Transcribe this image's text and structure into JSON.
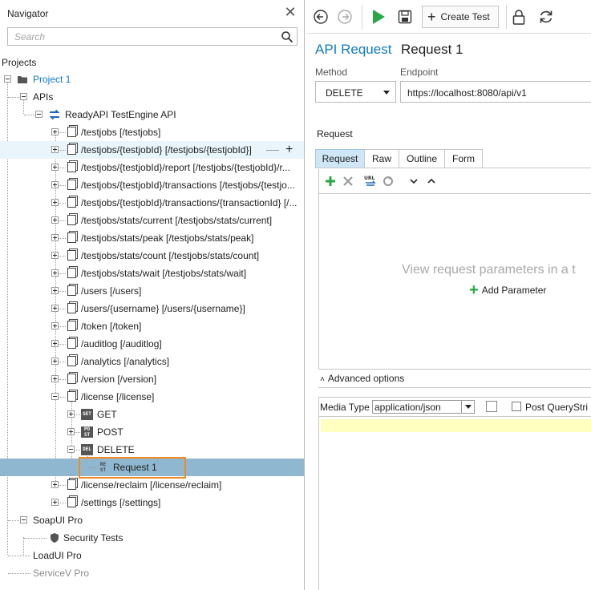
{
  "navigator": {
    "title": "Navigator",
    "search_placeholder": "Search",
    "projects_label": "Projects",
    "tree": [
      {
        "label": "Project 1",
        "icon": "folder-icon",
        "accent": true
      },
      {
        "label": "APIs"
      },
      {
        "label": "ReadyAPI TestEngine API",
        "icon": "api-icon"
      },
      {
        "label": "/testjobs [/testjobs]",
        "icon": "resource-icon"
      },
      {
        "label": "/testjobs/{testjobId} [/testjobs/{testjobId}]",
        "icon": "resource-icon"
      },
      {
        "label": "/testjobs/{testjobId}/report [/testjobs/{testjobId}/r...",
        "icon": "resource-icon"
      },
      {
        "label": "/testjobs/{testjobId}/transactions [/testjobs/{testjo...",
        "icon": "resource-icon"
      },
      {
        "label": "/testjobs/{testjobId}/transactions/{transactionId} [/...",
        "icon": "resource-icon"
      },
      {
        "label": "/testjobs/stats/current [/testjobs/stats/current]",
        "icon": "resource-icon"
      },
      {
        "label": "/testjobs/stats/peak [/testjobs/stats/peak]",
        "icon": "resource-icon"
      },
      {
        "label": "/testjobs/stats/count [/testjobs/stats/count]",
        "icon": "resource-icon"
      },
      {
        "label": "/testjobs/stats/wait [/testjobs/stats/wait]",
        "icon": "resource-icon"
      },
      {
        "label": "/users [/users]",
        "icon": "resource-icon"
      },
      {
        "label": "/users/{username} [/users/{username}]",
        "icon": "resource-icon"
      },
      {
        "label": "/token [/token]",
        "icon": "resource-icon"
      },
      {
        "label": "/auditlog [/auditlog]",
        "icon": "resource-icon"
      },
      {
        "label": "/analytics [/analytics]",
        "icon": "resource-icon"
      },
      {
        "label": "/version [/version]",
        "icon": "resource-icon"
      },
      {
        "label": "/license [/license]",
        "icon": "resource-icon"
      },
      {
        "label": "GET",
        "icon": "get-method-icon",
        "badge": "GET"
      },
      {
        "label": "POST",
        "icon": "post-method-icon",
        "badge": "POST"
      },
      {
        "label": "DELETE",
        "icon": "delete-method-icon",
        "badge": "DEL"
      },
      {
        "label": "Request 1",
        "icon": "rest-request-icon",
        "badge": "REST"
      },
      {
        "label": "/license/reclaim [/license/reclaim]",
        "icon": "resource-icon"
      },
      {
        "label": "/settings [/settings]",
        "icon": "resource-icon"
      },
      {
        "label": "SoapUI Pro"
      },
      {
        "label": "Security Tests",
        "icon": "shield-icon"
      },
      {
        "label": "LoadUI Pro"
      },
      {
        "label": "ServiceV Pro"
      }
    ]
  },
  "toolbar": {
    "back_icon": "back-icon",
    "forward_icon": "forward-icon",
    "run_icon": "run-icon",
    "save_icon": "save-icon",
    "create_test_label": "Create Test",
    "lock_icon": "lock-icon",
    "refresh_icon": "refresh-icon"
  },
  "request": {
    "type": "API Request",
    "name": "Request 1",
    "method_label": "Method",
    "method_value": "DELETE",
    "endpoint_label": "Endpoint",
    "endpoint_value": "https://localhost:8080/api/v1",
    "section_label": "Request",
    "tabs": [
      "Request",
      "Raw",
      "Outline",
      "Form"
    ],
    "active_tab": "Request",
    "empty_message": "View request parameters in a t",
    "add_parameter_label": "Add Parameter",
    "advanced_options_label": "Advanced options",
    "media_type_label": "Media Type",
    "media_type_value": "application/json",
    "post_query_string_label": "Post QueryStri"
  },
  "colors": {
    "accent": "#0e7ac4",
    "selection": "#8fb8d0",
    "hover_row": "#e9f4fb",
    "highlight_border": "#f08a24",
    "run_green": "#2aa847",
    "editor_yellow": "#ffffc0"
  }
}
